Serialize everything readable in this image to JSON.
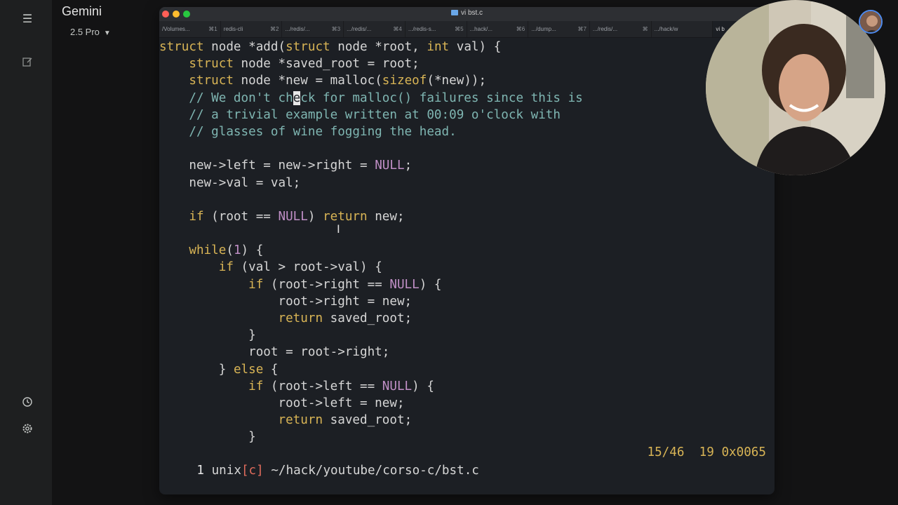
{
  "gemini": {
    "title": "Gemini",
    "model": "2.5 Pro",
    "icons": [
      "menu-icon",
      "new-chat-icon",
      "history-icon",
      "settings-icon"
    ]
  },
  "terminal": {
    "window_title": "vi bst.c",
    "tabs": [
      {
        "label": "/Volumes...",
        "kbd": "⌘1"
      },
      {
        "label": "redis-cli",
        "kbd": "⌘2"
      },
      {
        "label": ".../redis/...",
        "kbd": "⌘3"
      },
      {
        "label": ".../redis/...",
        "kbd": "⌘4"
      },
      {
        "label": ".../redis-s...",
        "kbd": "⌘5"
      },
      {
        "label": "...hack/...",
        "kbd": "⌘6"
      },
      {
        "label": ".../dump...",
        "kbd": "⌘7"
      },
      {
        "label": ".../redis/...",
        "kbd": "⌘"
      },
      {
        "label": ".../hack/w",
        "kbd": ""
      },
      {
        "label": "vi b",
        "kbd": ""
      }
    ],
    "status": {
      "buffer": "1",
      "format": "unix",
      "filetype": "[c]",
      "path": "~/hack/youtube/corso-c/bst.c",
      "line_pos": "15/46",
      "col": "19",
      "hex": "0x0065"
    }
  },
  "code_lines": [
    [
      {
        "t": "struct",
        "c": "kw"
      },
      {
        "t": " node *add("
      },
      {
        "t": "struct",
        "c": "kw"
      },
      {
        "t": " node *root, "
      },
      {
        "t": "int",
        "c": "kw"
      },
      {
        "t": " val) {"
      }
    ],
    [
      {
        "t": "    "
      },
      {
        "t": "struct",
        "c": "kw"
      },
      {
        "t": " node *saved_root = root;"
      }
    ],
    [
      {
        "t": "    "
      },
      {
        "t": "struct",
        "c": "kw"
      },
      {
        "t": " node *new = malloc("
      },
      {
        "t": "sizeof",
        "c": "kw"
      },
      {
        "t": "(*new));"
      }
    ],
    [
      {
        "t": "    // We don't ch",
        "c": "cm"
      },
      {
        "t": "e",
        "c": "cursor"
      },
      {
        "t": "ck for malloc() failures since this is",
        "c": "cm"
      }
    ],
    [
      {
        "t": "    // a trivial example written at 00:09 o'clock with",
        "c": "cm"
      }
    ],
    [
      {
        "t": "    // glasses of wine fogging the head.",
        "c": "cm"
      }
    ],
    [
      {
        "t": ""
      }
    ],
    [
      {
        "t": "    new->left = new->right = "
      },
      {
        "t": "NULL",
        "c": "nl"
      },
      {
        "t": ";"
      }
    ],
    [
      {
        "t": "    new->val = val;"
      }
    ],
    [
      {
        "t": ""
      }
    ],
    [
      {
        "t": "    "
      },
      {
        "t": "if",
        "c": "kw"
      },
      {
        "t": " (root == "
      },
      {
        "t": "NULL",
        "c": "nl"
      },
      {
        "t": ") "
      },
      {
        "t": "return",
        "c": "kw"
      },
      {
        "t": " new;"
      }
    ],
    [
      {
        "t": ""
      }
    ],
    [
      {
        "t": "    "
      },
      {
        "t": "while",
        "c": "kw"
      },
      {
        "t": "("
      },
      {
        "t": "1",
        "c": "num"
      },
      {
        "t": ") {"
      }
    ],
    [
      {
        "t": "        "
      },
      {
        "t": "if",
        "c": "kw"
      },
      {
        "t": " (val > root->val) {"
      }
    ],
    [
      {
        "t": "            "
      },
      {
        "t": "if",
        "c": "kw"
      },
      {
        "t": " (root->right == "
      },
      {
        "t": "NULL",
        "c": "nl"
      },
      {
        "t": ") {"
      }
    ],
    [
      {
        "t": "                root->right = new;"
      }
    ],
    [
      {
        "t": "                "
      },
      {
        "t": "return",
        "c": "kw"
      },
      {
        "t": " saved_root;"
      }
    ],
    [
      {
        "t": "            }"
      }
    ],
    [
      {
        "t": "            root = root->right;"
      }
    ],
    [
      {
        "t": "        } "
      },
      {
        "t": "else",
        "c": "kw"
      },
      {
        "t": " {"
      }
    ],
    [
      {
        "t": "            "
      },
      {
        "t": "if",
        "c": "kw"
      },
      {
        "t": " (root->left == "
      },
      {
        "t": "NULL",
        "c": "nl"
      },
      {
        "t": ") {"
      }
    ],
    [
      {
        "t": "                root->left = new;"
      }
    ],
    [
      {
        "t": "                "
      },
      {
        "t": "return",
        "c": "kw"
      },
      {
        "t": " saved_root;"
      }
    ],
    [
      {
        "t": "            }"
      }
    ]
  ]
}
